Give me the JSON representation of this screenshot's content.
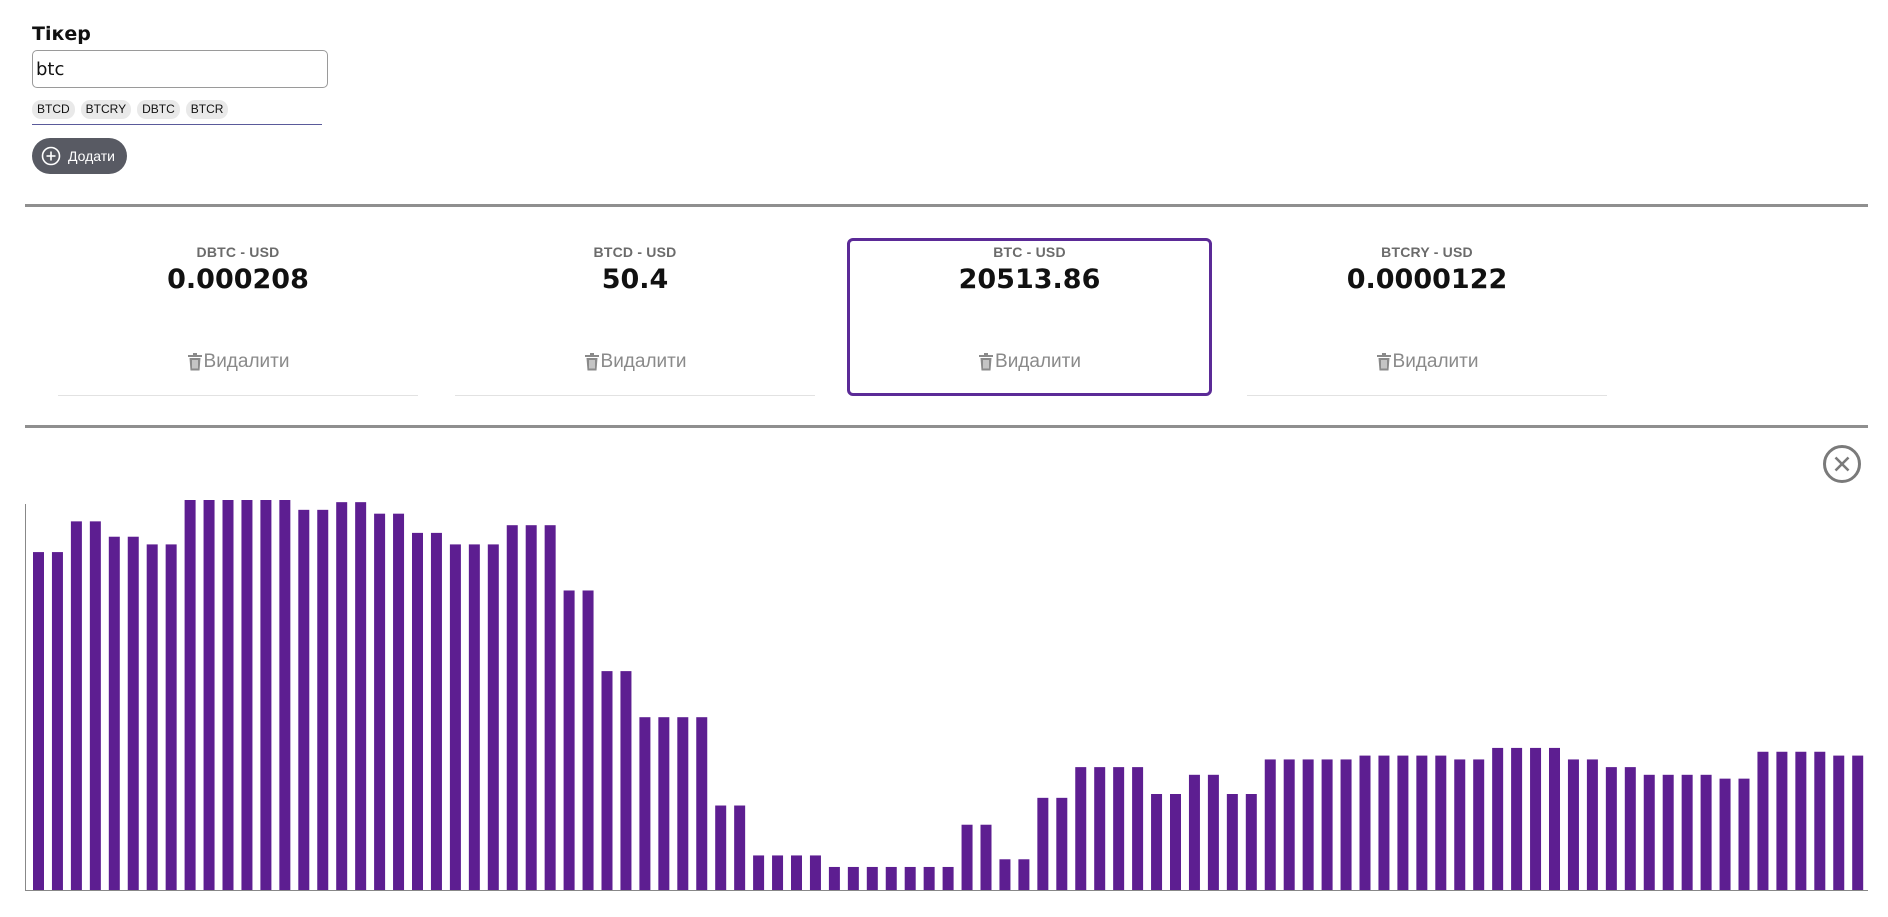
{
  "add_form": {
    "ticker_label": "Тікер",
    "ticker_value": "btc",
    "suggestions": [
      "BTCD",
      "BTCRY",
      "DBTC",
      "BTCR"
    ],
    "add_button_label": "Додати"
  },
  "tickers": [
    {
      "pair": "DBTC - USD",
      "price": "0.000208",
      "delete_label": "Видалити",
      "selected": false
    },
    {
      "pair": "BTCD - USD",
      "price": "50.4",
      "delete_label": "Видалити",
      "selected": false
    },
    {
      "pair": "BTC - USD",
      "price": "20513.86",
      "delete_label": "Видалити",
      "selected": true
    },
    {
      "pair": "BTCRY - USD",
      "price": "0.0000122",
      "delete_label": "Видалити",
      "selected": false
    }
  ],
  "chart_data": {
    "type": "bar",
    "bar_color": "#5d1e91",
    "ylim": [
      0,
      1
    ],
    "values": [
      0.88,
      0.88,
      0.96,
      0.96,
      0.92,
      0.92,
      0.9,
      0.9,
      1.06,
      1.06,
      1.06,
      1.06,
      1.06,
      1.06,
      0.99,
      0.99,
      1.01,
      1.01,
      0.98,
      0.98,
      0.93,
      0.93,
      0.9,
      0.9,
      0.9,
      0.95,
      0.95,
      0.95,
      0.78,
      0.78,
      0.57,
      0.57,
      0.45,
      0.45,
      0.45,
      0.45,
      0.22,
      0.22,
      0.09,
      0.09,
      0.09,
      0.09,
      0.06,
      0.06,
      0.06,
      0.06,
      0.06,
      0.06,
      0.06,
      0.17,
      0.17,
      0.08,
      0.08,
      0.24,
      0.24,
      0.32,
      0.32,
      0.32,
      0.32,
      0.25,
      0.25,
      0.3,
      0.3,
      0.25,
      0.25,
      0.34,
      0.34,
      0.34,
      0.34,
      0.34,
      0.35,
      0.35,
      0.35,
      0.35,
      0.35,
      0.34,
      0.34,
      0.37,
      0.37,
      0.37,
      0.37,
      0.34,
      0.34,
      0.32,
      0.32,
      0.3,
      0.3,
      0.3,
      0.3,
      0.29,
      0.29,
      0.36,
      0.36,
      0.36,
      0.36,
      0.35,
      0.35,
      0.33,
      0.33,
      0.28
    ]
  }
}
